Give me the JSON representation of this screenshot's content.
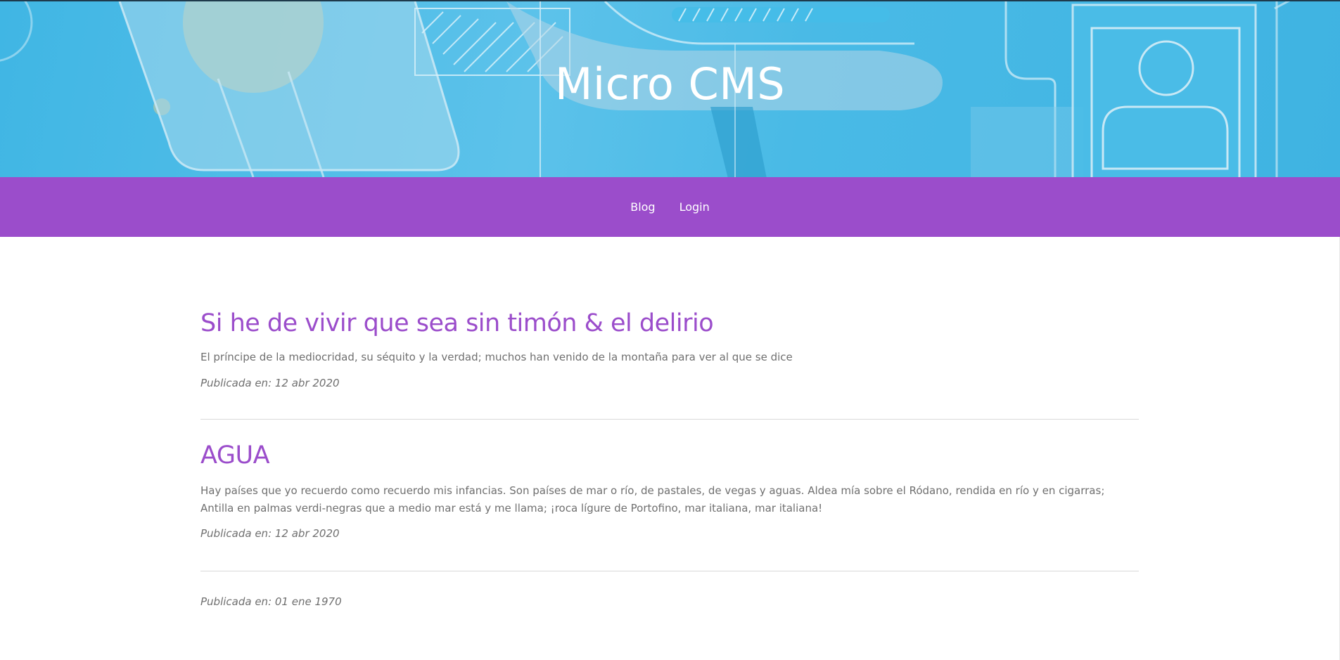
{
  "header": {
    "title": "Micro CMS"
  },
  "nav": {
    "items": [
      {
        "label": "Blog"
      },
      {
        "label": "Login"
      }
    ]
  },
  "posts": [
    {
      "title": "Si he de vivir que sea sin timón & el delirio",
      "excerpt": "El príncipe de la mediocridad, su séquito y la verdad; muchos han venido de la montaña para ver al que se dice",
      "date": "Publicada en: 12 abr 2020"
    },
    {
      "title": "AGUA",
      "excerpt": "Hay países que yo recuerdo como recuerdo mis infancias. Son países de mar o río, de pastales, de vegas y aguas. Aldea mía sobre el Ródano, rendida en río y en cigarras; Antilla en palmas verdi-negras que a medio mar está y me llama; ¡roca lígure de Portofino, mar italiana, mar italiana!",
      "date": "Publicada en: 12 abr 2020"
    },
    {
      "title": "",
      "excerpt": "",
      "date": "Publicada en: 01 ene 1970"
    }
  ],
  "colors": {
    "accent": "#9b4dcb",
    "hero": "#4ab9e5",
    "text": "#6f6f6f"
  }
}
